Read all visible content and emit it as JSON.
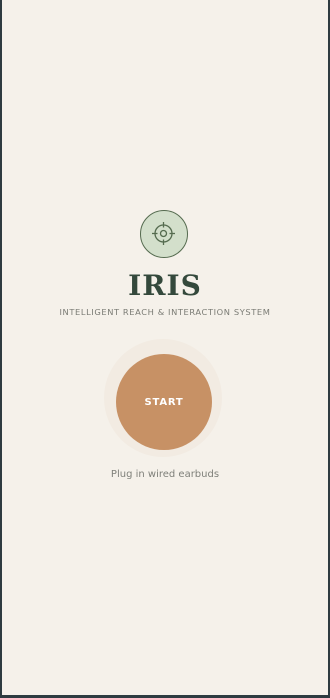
{
  "app": {
    "title": "IRIS",
    "subtitle": "INTELLIGENT REACH & INTERACTION SYSTEM",
    "logo_icon": "crosshair-icon"
  },
  "actions": {
    "start_label": "START"
  },
  "status": {
    "hint": "Plug in wired earbuds"
  },
  "colors": {
    "background": "#f5f1ea",
    "frame": "#2e3b40",
    "accent": "#c79165",
    "title": "#34493c",
    "logo_fill": "#d3dfcb",
    "logo_stroke": "#556b4f"
  }
}
